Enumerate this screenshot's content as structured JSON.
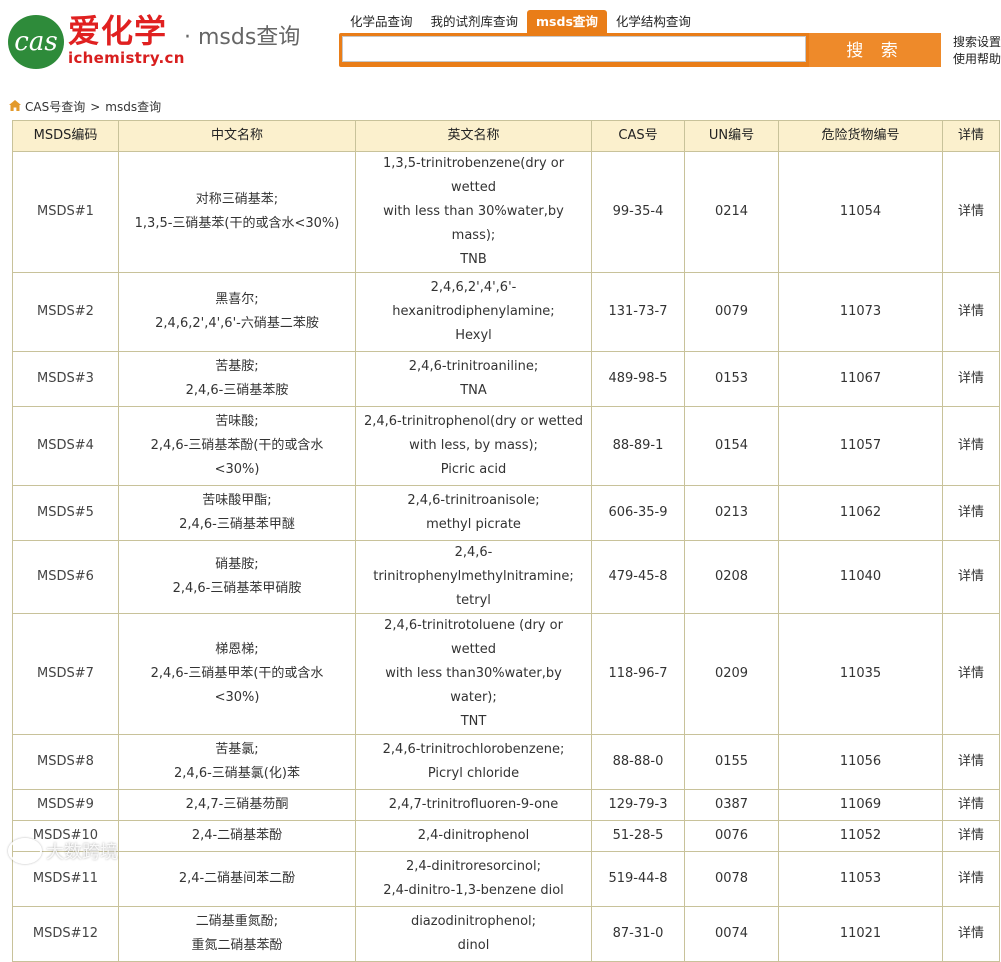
{
  "logo": {
    "badge_text": "cas",
    "name": "爱化学",
    "domain": "ichemistry.cn",
    "sub": "· msds查询"
  },
  "tabs": [
    {
      "label": "化学品查询",
      "active": false
    },
    {
      "label": "我的试剂库查询",
      "active": false
    },
    {
      "label": "msds查询",
      "active": true
    },
    {
      "label": "化学结构查询",
      "active": false
    }
  ],
  "search": {
    "value": "",
    "button_label": "搜 索"
  },
  "side_links": {
    "advanced": "搜索设置",
    "help": "使用帮助"
  },
  "breadcrumb": {
    "home": "CAS号查询",
    "separator": ">",
    "current": "msds查询"
  },
  "table": {
    "headers": [
      "MSDS编码",
      "中文名称",
      "英文名称",
      "CAS号",
      "UN编号",
      "危险货物编号",
      "详情"
    ],
    "rows": [
      {
        "code": "MSDS#1",
        "cn": [
          "对称三硝基苯;",
          "1,3,5-三硝基苯(干的或含水<30%)"
        ],
        "en": [
          "1,3,5-trinitrobenzene(dry or wetted",
          "with less than 30%water,by mass);",
          "TNB"
        ],
        "cas": "99-35-4",
        "un": "0214",
        "dg": "11054",
        "detail": "详情"
      },
      {
        "code": "MSDS#2",
        "cn": [
          "黑喜尔;",
          "2,4,6,2',4',6'-六硝基二苯胺"
        ],
        "en": [
          "2,4,6,2',4',6'-",
          "hexanitrodiphenylamine;",
          "Hexyl"
        ],
        "cas": "131-73-7",
        "un": "0079",
        "dg": "11073",
        "detail": "详情"
      },
      {
        "code": "MSDS#3",
        "cn": [
          "苦基胺;",
          "2,4,6-三硝基苯胺"
        ],
        "en": [
          "2,4,6-trinitroaniline;",
          "TNA"
        ],
        "cas": "489-98-5",
        "un": "0153",
        "dg": "11067",
        "detail": "详情"
      },
      {
        "code": "MSDS#4",
        "cn": [
          "苦味酸;",
          "2,4,6-三硝基苯酚(干的或含水",
          "<30%)"
        ],
        "en": [
          "2,4,6-trinitrophenol(dry or wetted",
          "with less, by mass);",
          "Picric acid"
        ],
        "cas": "88-89-1",
        "un": "0154",
        "dg": "11057",
        "detail": "详情"
      },
      {
        "code": "MSDS#5",
        "cn": [
          "苦味酸甲酯;",
          "2,4,6-三硝基苯甲醚"
        ],
        "en": [
          "2,4,6-trinitroanisole;",
          "methyl picrate"
        ],
        "cas": "606-35-9",
        "un": "0213",
        "dg": "11062",
        "detail": "详情"
      },
      {
        "code": "MSDS#6",
        "cn": [
          "硝基胺;",
          "2,4,6-三硝基苯甲硝胺"
        ],
        "en": [
          "2,4,6-trinitrophenylmethylnitramine;",
          "tetryl"
        ],
        "cas": "479-45-8",
        "un": "0208",
        "dg": "11040",
        "detail": "详情"
      },
      {
        "code": "MSDS#7",
        "cn": [
          "梯恩梯;",
          "2,4,6-三硝基甲苯(干的或含水",
          "<30%)"
        ],
        "en": [
          "2,4,6-trinitrotoluene (dry or wetted",
          "with less than30%water,by water);",
          "TNT"
        ],
        "cas": "118-96-7",
        "un": "0209",
        "dg": "11035",
        "detail": "详情"
      },
      {
        "code": "MSDS#8",
        "cn": [
          "苦基氯;",
          "2,4,6-三硝基氯(化)苯"
        ],
        "en": [
          "2,4,6-trinitrochlorobenzene;",
          "Picryl chloride"
        ],
        "cas": "88-88-0",
        "un": "0155",
        "dg": "11056",
        "detail": "详情"
      },
      {
        "code": "MSDS#9",
        "cn": [
          "2,4,7-三硝基芴酮"
        ],
        "en": [
          "2,4,7-trinitrofluoren-9-one"
        ],
        "cas": "129-79-3",
        "un": "0387",
        "dg": "11069",
        "detail": "详情"
      },
      {
        "code": "MSDS#10",
        "cn": [
          "2,4-二硝基苯酚"
        ],
        "en": [
          "2,4-dinitrophenol"
        ],
        "cas": "51-28-5",
        "un": "0076",
        "dg": "11052",
        "detail": "详情"
      },
      {
        "code": "MSDS#11",
        "cn": [
          "2,4-二硝基间苯二酚"
        ],
        "en": [
          "2,4-dinitroresorcinol;",
          "2,4-dinitro-1,3-benzene diol"
        ],
        "cas": "519-44-8",
        "un": "0078",
        "dg": "11053",
        "detail": "详情"
      },
      {
        "code": "MSDS#12",
        "cn": [
          "二硝基重氮酚;",
          "重氮二硝基苯酚"
        ],
        "en": [
          "diazodinitrophenol;",
          "dinol"
        ],
        "cas": "87-31-0",
        "un": "0074",
        "dg": "11021",
        "detail": "详情"
      }
    ]
  },
  "watermark": "大数跨境"
}
